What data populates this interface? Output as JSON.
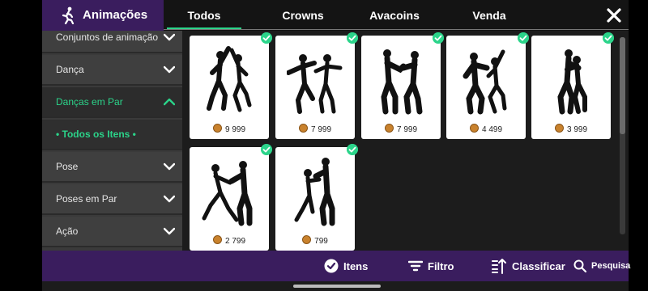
{
  "header": {
    "title": "Animações",
    "tabs": [
      {
        "label": "Todos",
        "active": true
      },
      {
        "label": "Crowns",
        "active": false
      },
      {
        "label": "Avacoins",
        "active": false
      },
      {
        "label": "Venda",
        "active": false
      }
    ]
  },
  "sidebar": {
    "items": [
      {
        "label": "Conjuntos de animação",
        "state": "collapsed"
      },
      {
        "label": "Dança",
        "state": "collapsed"
      },
      {
        "label": "Danças em Par",
        "state": "expanded"
      },
      {
        "label": "Pose",
        "state": "collapsed"
      },
      {
        "label": "Poses em Par",
        "state": "collapsed"
      },
      {
        "label": "Ação",
        "state": "collapsed"
      }
    ],
    "subitem": "•  Todos os Itens  •"
  },
  "items": [
    {
      "price": "9 999",
      "owned": true,
      "icon": "couple-jump-dance-icon"
    },
    {
      "price": "7 999",
      "owned": true,
      "icon": "couple-spread-arms-dance-icon"
    },
    {
      "price": "7 999",
      "owned": true,
      "icon": "couple-hands-together-dance-icon"
    },
    {
      "price": "4 499",
      "owned": true,
      "icon": "couple-spin-dance-icon"
    },
    {
      "price": "3 999",
      "owned": true,
      "icon": "couple-embrace-dance-icon"
    },
    {
      "price": "2 799",
      "owned": true,
      "icon": "couple-tango-dance-icon"
    },
    {
      "price": "799",
      "owned": true,
      "icon": "couple-lift-dance-icon"
    }
  ],
  "bottom_bar": {
    "items_label": "Itens",
    "filter_label": "Filtro",
    "sort_label": "Classificar",
    "search_label": "Pesquisa"
  },
  "colors": {
    "accent": "#2bd48a",
    "brand_purple": "#3a1d5e",
    "coin": "#c9822d"
  }
}
